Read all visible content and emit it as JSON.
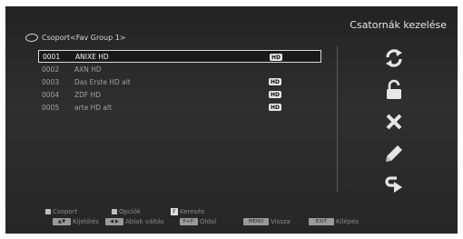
{
  "panel_title": "Csatornák kezelése",
  "group": {
    "label": "Csoport<Fav Group 1>"
  },
  "channels": [
    {
      "num": "0001",
      "name": "ANIXE HD",
      "badge": "HD"
    },
    {
      "num": "0002",
      "name": "AXN HD",
      "badge": ""
    },
    {
      "num": "0003",
      "name": "Das Erste HD alt",
      "badge": "HD"
    },
    {
      "num": "0004",
      "name": "ZDF HD",
      "badge": "HD"
    },
    {
      "num": "0005",
      "name": "arte HD alt",
      "badge": "HD"
    }
  ],
  "selected_index": 0,
  "actions": [
    {
      "icon": "sync-arrows-icon"
    },
    {
      "icon": "lock-icon"
    },
    {
      "icon": "delete-x-icon"
    },
    {
      "icon": "pencil-icon"
    },
    {
      "icon": "move-arrow-icon"
    }
  ],
  "legend": {
    "row1": {
      "group": "Csoport",
      "options": "Opciók",
      "find_key": "F",
      "find": "Keresés"
    },
    "row2": {
      "select_key": "▲▼",
      "select": "Kijelölés",
      "switch_key": "◀ ▶",
      "switch": "Ablak váltás",
      "page_key": "P+P-",
      "page": "Oldal",
      "menu_key": "MENU",
      "back": "Vissza",
      "exit_key": "EXIT",
      "exit": "Kilépés"
    }
  },
  "colors": {
    "background": "#2a2a2a",
    "text_dim": "#a0a0a0",
    "text_selected": "#f2f2f2",
    "icon": "#e6e6e6"
  }
}
